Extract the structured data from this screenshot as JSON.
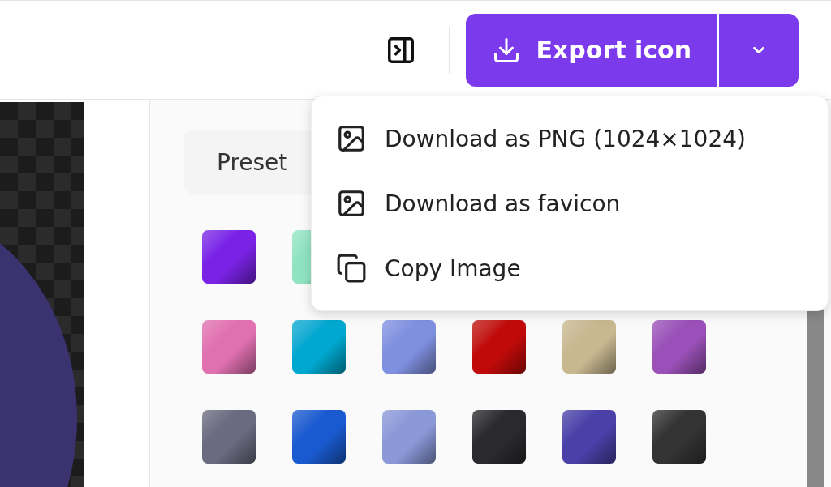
{
  "toolbar": {
    "export_button": {
      "label": "Export icon"
    }
  },
  "export_menu": {
    "open": true,
    "items": [
      {
        "kind": "image",
        "label": "Download as PNG (1024×1024)"
      },
      {
        "kind": "image",
        "label": "Download as favicon"
      },
      {
        "kind": "copy",
        "label": "Copy Image"
      }
    ]
  },
  "panel": {
    "tabs": [
      {
        "label": "Preset",
        "selected": true
      }
    ],
    "swatch_rows": [
      [
        {
          "color": "#7a22e6"
        },
        {
          "color": "#8fe3c2"
        }
      ],
      [
        {
          "color": "#e070b0"
        },
        {
          "color": "#00a8d0"
        },
        {
          "color": "#8090e0"
        },
        {
          "color": "#c00a0a"
        },
        {
          "color": "#c8b890"
        },
        {
          "color": "#9a50b8"
        }
      ],
      [
        {
          "color": "#6a6a80"
        },
        {
          "color": "#1a5ad0"
        },
        {
          "color": "#8a98d8"
        },
        {
          "color": "#2a2a2e"
        },
        {
          "color": "#4a40a8"
        },
        {
          "color": "#333333"
        }
      ]
    ]
  }
}
